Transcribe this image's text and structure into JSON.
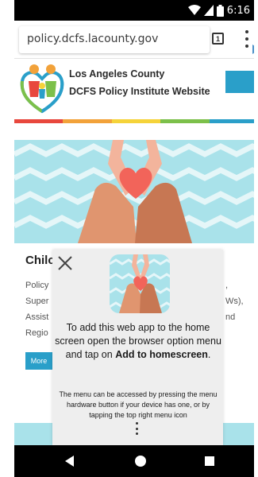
{
  "status_bar": {
    "time": "6:16"
  },
  "browser": {
    "url": "policy.dcfs.lacounty.gov",
    "tab_count": "1"
  },
  "site_header": {
    "title_line1": "Los Angeles County",
    "title_line2": "DCFS Policy Institute Website"
  },
  "content": {
    "title": "Chilc",
    "lines": [
      {
        "left": "Policy",
        "right": ","
      },
      {
        "left": "Super",
        "right": "Ws),"
      },
      {
        "left": "Assist",
        "right": "nd"
      },
      {
        "left": "Regio",
        "right": ""
      }
    ],
    "more_label": "More"
  },
  "dialog": {
    "main_text": "To add this web app to the home screen open the browser option menu and tap on",
    "main_bold": "Add to homescreen",
    "main_end": ".",
    "sub_text": "The menu can be accessed by pressing the menu hardware button if your device has one, or by tapping the top right menu icon"
  },
  "colors": {
    "accent_blue": "#2a9fc9",
    "hero_teal": "#a9e2ea",
    "stripe": [
      "#e8473d",
      "#f2a23a",
      "#f5d33a",
      "#7cc04a",
      "#2a9fc9"
    ]
  }
}
